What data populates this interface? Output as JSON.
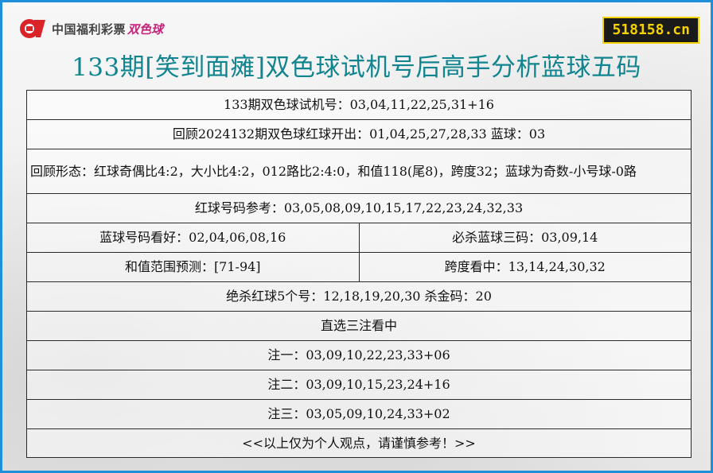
{
  "header": {
    "logo_text": "中国福利彩票",
    "logo_brand": "双色球",
    "site": "518158.cn"
  },
  "title": "133期[笑到面瘫]双色球试机号后高手分析蓝球五码",
  "rows": {
    "trial_numbers": "133期双色球试机号：03,04,11,22,25,31+16",
    "review_draw": "回顾2024132期双色球红球开出：01,04,25,27,28,33 蓝球：03",
    "review_pattern": "回顾形态：红球奇偶比4:2，大小比4:2，012路比2:4:0，和值118(尾8)，跨度32；蓝球为奇数-小号球-0路",
    "red_reference": "红球号码参考：03,05,08,09,10,15,17,22,23,24,32,33",
    "blue_favored": "蓝球号码看好：02,04,06,08,16",
    "blue_kill": "必杀蓝球三码：03,09,14",
    "sum_range": "和值范围预测：[71-94]",
    "span_pick": "跨度看中：13,14,24,30,32",
    "red_kill": "绝杀红球5个号：12,18,19,20,30 杀金码：20",
    "direct_heading": "直选三注看中",
    "pick_1": "注一：03,09,10,22,23,33+06",
    "pick_2": "注二：03,09,10,15,23,24+16",
    "pick_3": "注三：03,05,09,10,24,33+02",
    "disclaimer": "<<以上仅为个人观点，请谨慎参考！>>"
  },
  "colors": {
    "border": "#1e8fd8",
    "title": "#11858f",
    "logo_red": "#d9252a",
    "brand": "#c6237a",
    "badge_bg": "#1a1a1a",
    "badge_text": "#f5d200"
  }
}
